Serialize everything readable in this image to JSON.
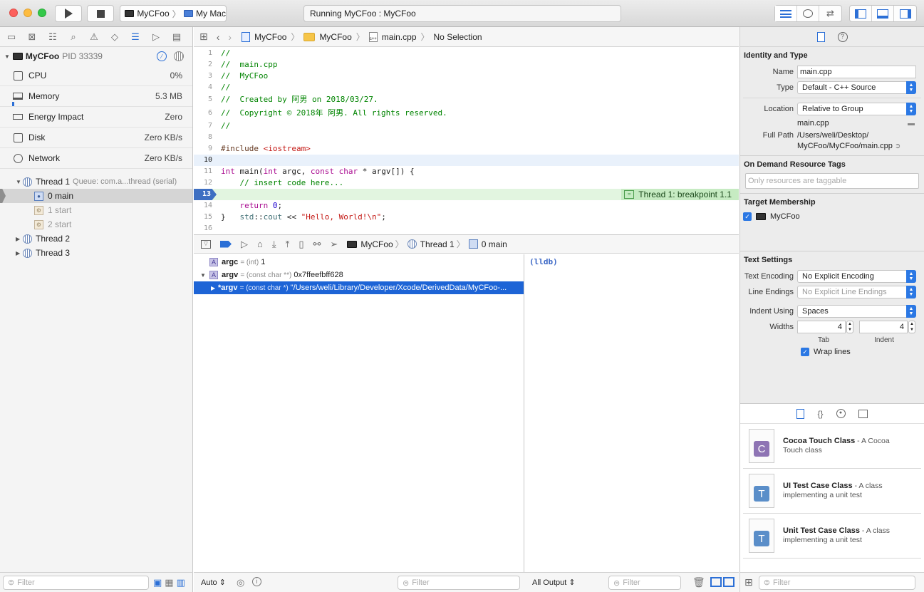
{
  "toolbar": {
    "scheme_target": "MyCFoo",
    "scheme_device": "My Mac",
    "activity_status": "Running MyCFoo : MyCFoo"
  },
  "navigator": {
    "process_name": "MyCFoo",
    "process_pid": "PID 33339",
    "gauges": [
      {
        "name": "CPU",
        "value": "0%"
      },
      {
        "name": "Memory",
        "value": "5.3 MB"
      },
      {
        "name": "Energy Impact",
        "value": "Zero"
      },
      {
        "name": "Disk",
        "value": "Zero KB/s"
      },
      {
        "name": "Network",
        "value": "Zero KB/s"
      }
    ],
    "thread1_label": "Thread 1",
    "thread1_queue": "Queue: com.a...thread (serial)",
    "frames": [
      "0 main",
      "1 start",
      "2 start"
    ],
    "thread2_label": "Thread 2",
    "thread3_label": "Thread 3",
    "filter_placeholder": "Filter"
  },
  "jumpbar": {
    "project": "MyCFoo",
    "group": "MyCFoo",
    "file": "main.cpp",
    "selection": "No Selection"
  },
  "code": {
    "line_numbers": [
      "1",
      "2",
      "3",
      "4",
      "5",
      "6",
      "7",
      "8",
      "9",
      "10",
      "11",
      "12",
      "13",
      "14",
      "15",
      "16"
    ],
    "l1": "//",
    "l2": "//  main.cpp",
    "l3": "//  MyCFoo",
    "l4": "//",
    "l5": "//  Created by 阿男 on 2018/03/27.",
    "l6": "//  Copyright © 2018年 阿男. All rights reserved.",
    "l7": "//",
    "l9_pp": "#include ",
    "l9_inc": "<iostream>",
    "l11_int": "int",
    "l11_a": " main(",
    "l11_int2": "int",
    "l11_b": " argc, ",
    "l11_const": "const",
    "l11_sp": " ",
    "l11_char": "char",
    "l11_c": " * argv[]) {",
    "l12": "    // insert code here...",
    "l13_std": "std",
    "l13_sep": "::",
    "l13_cout": "cout",
    "l13_op": " << ",
    "l13_str": "\"Hello, World!\\n\"",
    "l13_end": ";",
    "l14_ret": "return",
    "l14_sp": " ",
    "l14_num": "0",
    "l14_end": ";",
    "l15": "}",
    "breakpoint_label": "Thread 1: breakpoint 1.1"
  },
  "debugbar": {
    "process": "MyCFoo",
    "thread": "Thread 1",
    "frame": "0 main"
  },
  "variables": [
    {
      "name": "argc",
      "type": "= (int)",
      "value": "1"
    },
    {
      "name": "argv",
      "type": "= (const char **)",
      "value": "0x7ffeefbff628"
    },
    {
      "name": "*argv",
      "type": "= (const char *)",
      "value": "\"/Users/weli/Library/Developer/Xcode/DerivedData/MyCFoo-..."
    }
  ],
  "console": {
    "prompt": "(lldb)"
  },
  "bottom": {
    "auto_label": "Auto",
    "vars_filter": "Filter",
    "output_label": "All Output",
    "console_filter": "Filter"
  },
  "inspector": {
    "identity_title": "Identity and Type",
    "name_label": "Name",
    "name_value": "main.cpp",
    "type_label": "Type",
    "type_value": "Default - C++ Source",
    "location_label": "Location",
    "location_value": "Relative to Group",
    "location_file": "main.cpp",
    "fullpath_label": "Full Path",
    "fullpath_value1": "/Users/weli/Desktop/",
    "fullpath_value2": "MyCFoo/MyCFoo/main.cpp",
    "odr_title": "On Demand Resource Tags",
    "odr_placeholder": "Only resources are taggable",
    "target_title": "Target Membership",
    "target_name": "MyCFoo",
    "text_title": "Text Settings",
    "encoding_label": "Text Encoding",
    "encoding_value": "No Explicit Encoding",
    "lineend_label": "Line Endings",
    "lineend_value": "No Explicit Line Endings",
    "indent_label": "Indent Using",
    "indent_value": "Spaces",
    "widths_label": "Widths",
    "tab_value": "4",
    "indent_width_value": "4",
    "tab_label": "Tab",
    "indent_caption": "Indent",
    "wrap_label": "Wrap lines"
  },
  "library": {
    "items": [
      {
        "title": "Cocoa Touch Class",
        "desc": " - A Cocoa Touch class",
        "letter": "C"
      },
      {
        "title": "UI Test Case Class",
        "desc": " - A class implementing a unit test",
        "letter": "T"
      },
      {
        "title": "Unit Test Case Class",
        "desc": " - A class implementing a unit test",
        "letter": "T"
      }
    ],
    "filter_placeholder": "Filter"
  }
}
